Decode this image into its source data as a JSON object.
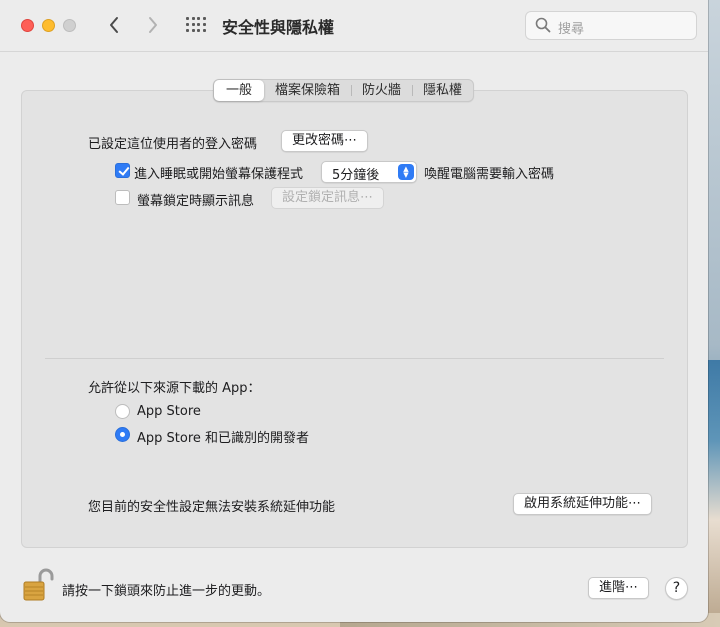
{
  "window": {
    "title": "安全性與隱私權",
    "search_placeholder": "搜尋"
  },
  "tabs": [
    {
      "label": "一般",
      "active": true
    },
    {
      "label": "檔案保險箱",
      "active": false
    },
    {
      "label": "防火牆",
      "active": false
    },
    {
      "label": "隱私權",
      "active": false
    }
  ],
  "general": {
    "password_label": "已設定這位使用者的登入密碼",
    "change_password_button": "更改密碼⋯",
    "require_password": {
      "checked": true,
      "label": "進入睡眠或開始螢幕保護程式",
      "delay_value": "5分鐘後",
      "suffix": "喚醒電腦需要輸入密碼"
    },
    "show_message": {
      "checked": false,
      "label": "螢幕鎖定時顯示訊息",
      "button": "設定鎖定訊息⋯"
    }
  },
  "downloads": {
    "heading": "允許從以下來源下載的 App：",
    "options": [
      {
        "label": "App Store",
        "selected": false
      },
      {
        "label": "App Store 和已識別的開發者",
        "selected": true
      }
    ]
  },
  "extensions": {
    "message": "您目前的安全性設定無法安裝系統延伸功能",
    "button": "啟用系統延伸功能⋯"
  },
  "footer": {
    "lock_message": "請按一下鎖頭來防止進一步的更動。",
    "advanced_button": "進階⋯",
    "help_button": "?"
  },
  "colors": {
    "accent": "#2f7bf5",
    "close": "#fe5f57",
    "minimize": "#febc2e"
  }
}
